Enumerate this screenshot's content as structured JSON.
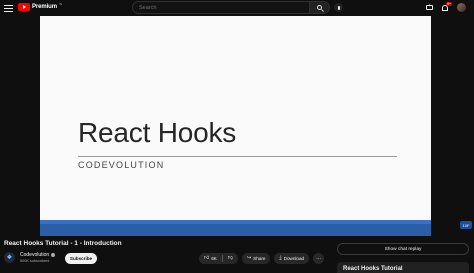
{
  "header": {
    "logo_text": "Premium",
    "logo_sup": "IN",
    "search_placeholder": "Search",
    "notification_count": "9+"
  },
  "player": {
    "slide_title": "React Hooks",
    "slide_subtitle": "CODEVOLUTION",
    "side_badge": "10F",
    "band_color": "#2a5ea8"
  },
  "video": {
    "title": "React Hooks Tutorial - 1 - Introduction"
  },
  "channel": {
    "name": "Codevolution",
    "subscribers": "500K subscribers",
    "avatar_letter": "❖",
    "subscribe_label": "Subscribe"
  },
  "actions": {
    "like_count": "6K",
    "share_label": "Share",
    "download_label": "Download",
    "more_label": "···"
  },
  "sidebar": {
    "chat_replay_label": "Show chat replay",
    "playlist_title": "React Hooks Tutorial"
  }
}
